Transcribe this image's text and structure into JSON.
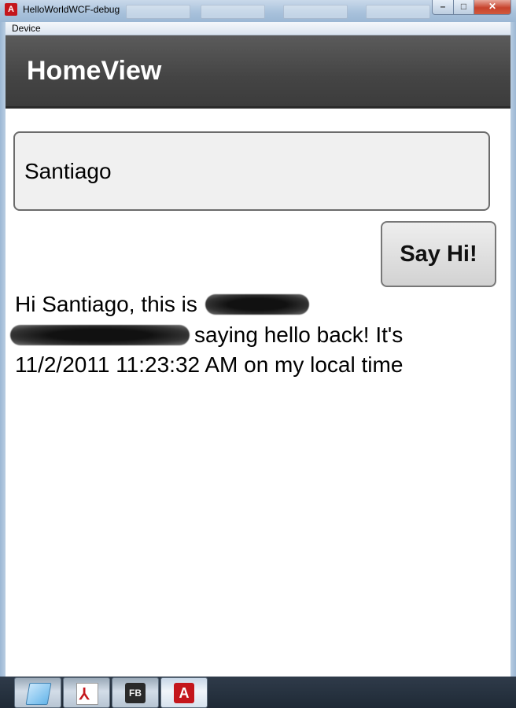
{
  "window": {
    "title": "HelloWorldWCF-debug",
    "app_icon_glyph": "A",
    "min_glyph": "–",
    "max_glyph": "□",
    "close_glyph": "✕"
  },
  "menubar": {
    "device_label": "Device"
  },
  "header": {
    "title": "HomeView"
  },
  "form": {
    "name_value": "Santiago",
    "say_hi_label": "Say Hi!"
  },
  "response": {
    "part1": "Hi Santiago, this is",
    "part2": "saying hello back! It's",
    "part3": "11/2/2011 11:23:32 AM on my local time"
  },
  "taskbar": {
    "items": [
      {
        "icon": "notepad-icon"
      },
      {
        "icon": "pdf-icon",
        "glyph": "⅄"
      },
      {
        "icon": "flash-builder-icon",
        "glyph": "FB"
      },
      {
        "icon": "adobe-air-icon",
        "glyph": "A"
      }
    ]
  },
  "colors": {
    "header_bg": "#444444",
    "input_bg": "#f0f0f0",
    "button_bg": "#dedede",
    "air_red": "#c4161c"
  }
}
